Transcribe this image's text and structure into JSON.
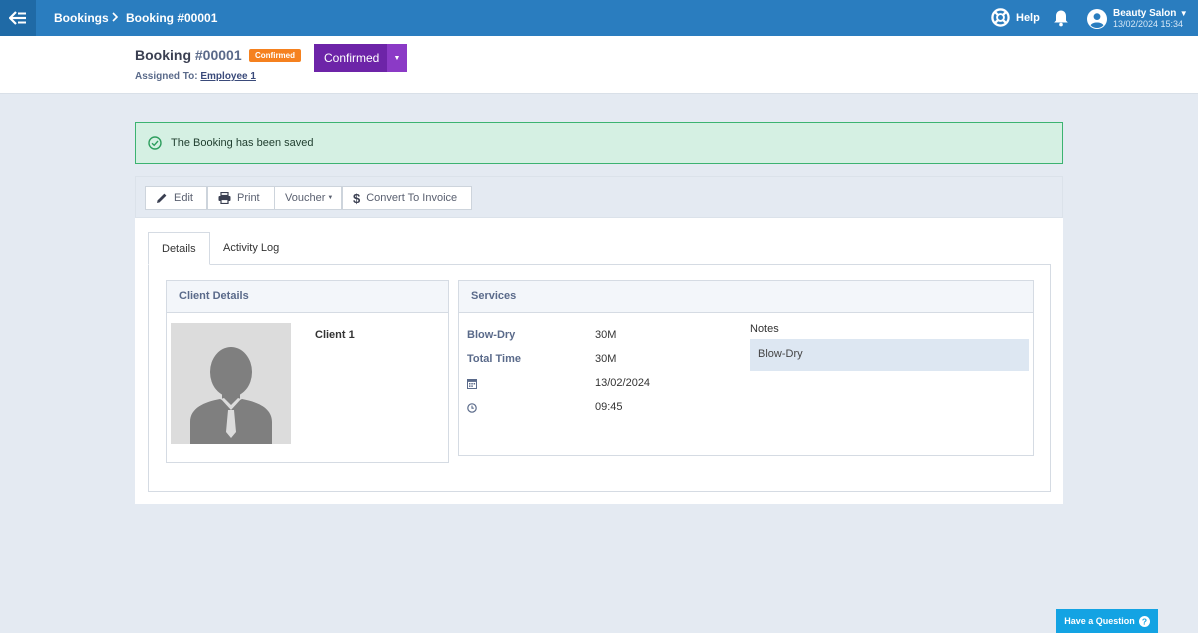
{
  "topbar": {
    "breadcrumb": [
      "Bookings",
      "Booking #00001"
    ],
    "help_label": "Help",
    "account_name": "Beauty Salon",
    "account_datetime": "13/02/2024 15:34"
  },
  "header": {
    "title_prefix": "Booking",
    "title_number": "#00001",
    "status_badge": "Confirmed",
    "assigned_label": "Assigned To:",
    "assigned_to": "Employee 1",
    "status_dropdown_value": "Confirmed"
  },
  "alert": {
    "message": "The Booking has been saved"
  },
  "toolbar": {
    "edit": "Edit",
    "print": "Print",
    "voucher": "Voucher",
    "convert": "Convert To Invoice"
  },
  "tabs": [
    "Details",
    "Activity Log"
  ],
  "client_panel": {
    "title": "Client Details",
    "client_name": "Client 1"
  },
  "services_panel": {
    "title": "Services",
    "rows": [
      {
        "label": "Blow-Dry",
        "value": "30M"
      },
      {
        "label": "Total Time",
        "value": "30M"
      }
    ],
    "date": "13/02/2024",
    "time": "09:45",
    "notes_label": "Notes",
    "notes_value": "Blow-Dry"
  },
  "ask_button": "Have a Question",
  "colors": {
    "topbar": "#2a7dbf",
    "status_purple": "#6d24a8",
    "badge_orange": "#f5811f",
    "alert_green": "#3cb371",
    "ask_blue": "#13a3e3"
  }
}
